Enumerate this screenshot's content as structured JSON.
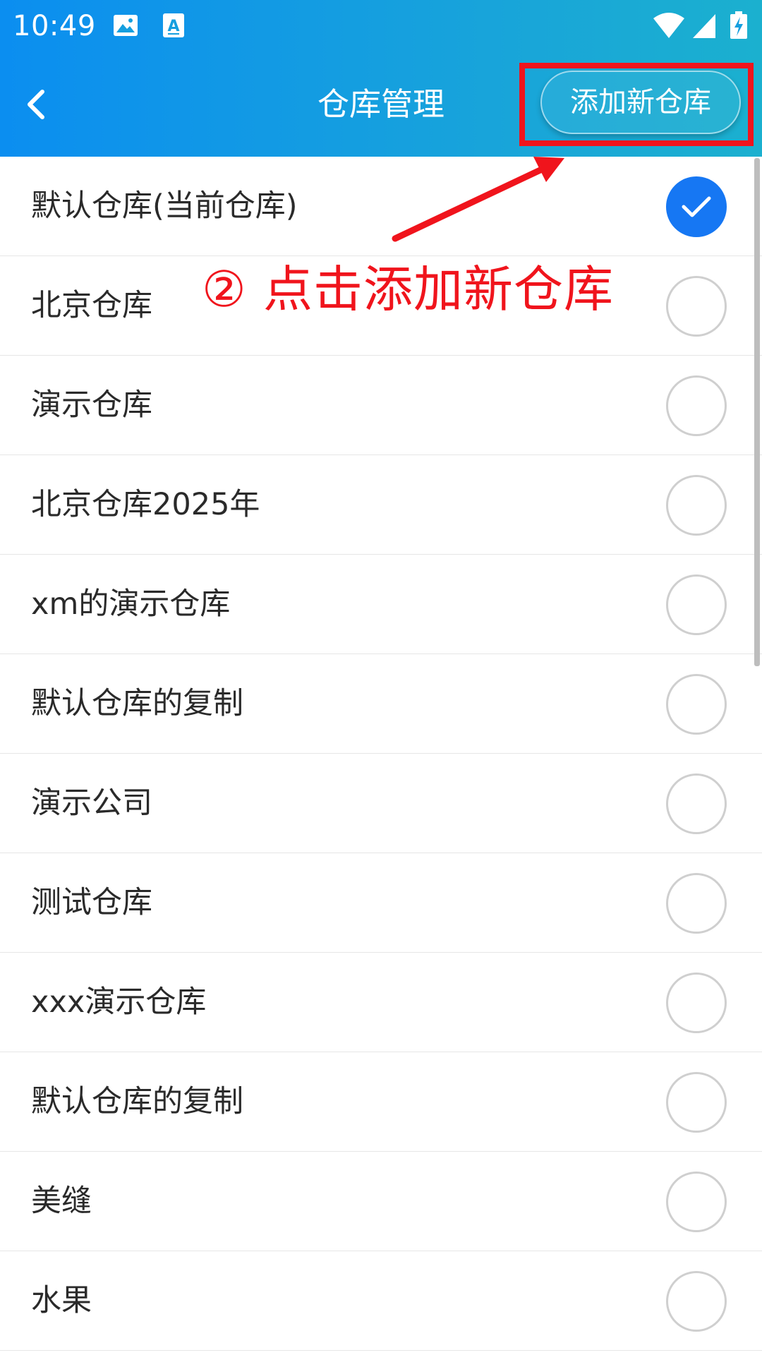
{
  "status_bar": {
    "time": "10:49",
    "icons": [
      "image-icon",
      "font-a-icon",
      "wifi-icon",
      "signal-icon",
      "battery-charging-icon"
    ]
  },
  "app_bar": {
    "title": "仓库管理",
    "back_icon": "chevron-left-icon",
    "add_button_label": "添加新仓库"
  },
  "annotation": {
    "text": "② 点击添加新仓库",
    "color": "#f0141c"
  },
  "warehouses": [
    {
      "label": "默认仓库(当前仓库)",
      "checked": true
    },
    {
      "label": "北京仓库",
      "checked": false
    },
    {
      "label": "演示仓库",
      "checked": false
    },
    {
      "label": "北京仓库2025年",
      "checked": false
    },
    {
      "label": "xm的演示仓库",
      "checked": false
    },
    {
      "label": "默认仓库的复制",
      "checked": false
    },
    {
      "label": "演示公司",
      "checked": false
    },
    {
      "label": "测试仓库",
      "checked": false
    },
    {
      "label": "xxx演示仓库",
      "checked": false
    },
    {
      "label": "默认仓库的复制",
      "checked": false
    },
    {
      "label": "美缝",
      "checked": false
    },
    {
      "label": "水果",
      "checked": false
    }
  ],
  "colors": {
    "header_start": "#0b8ef0",
    "header_end": "#1bb0cf",
    "radio_checked": "#1677f3",
    "radio_unchecked": "#cfcfcf",
    "annotation_red": "#f0141c"
  }
}
